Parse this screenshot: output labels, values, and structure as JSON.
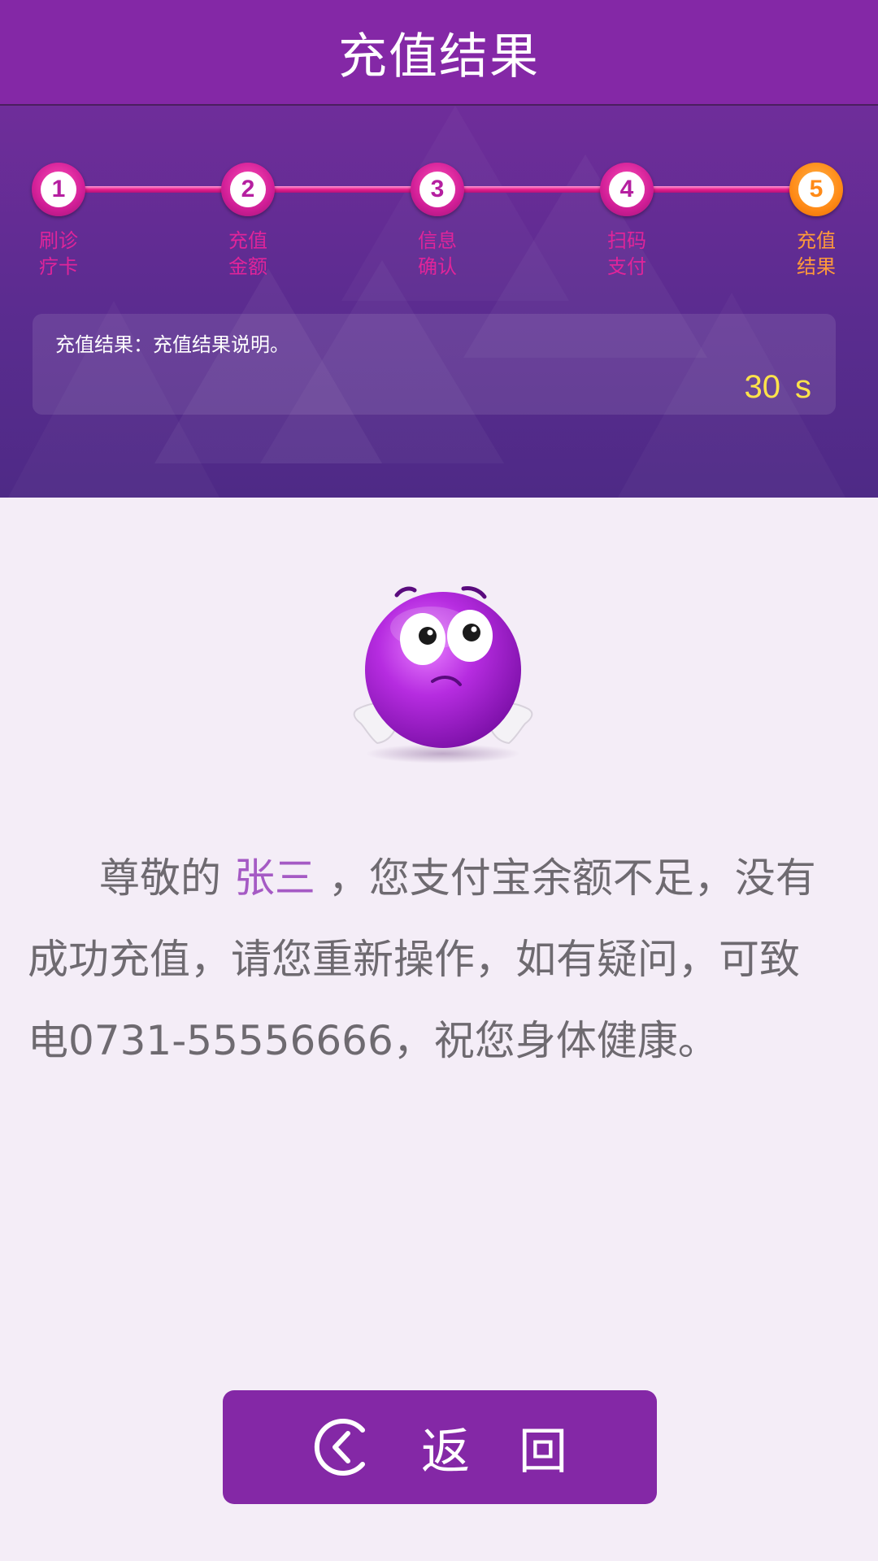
{
  "header": {
    "title": "充值结果"
  },
  "steps": [
    {
      "number": "1",
      "line1": "刷诊",
      "line2": "疗卡"
    },
    {
      "number": "2",
      "line1": "充值",
      "line2": "金额"
    },
    {
      "number": "3",
      "line1": "信息",
      "line2": "确认"
    },
    {
      "number": "4",
      "line1": "扫码",
      "line2": "支付"
    },
    {
      "number": "5",
      "line1": "充值",
      "line2": "结果"
    }
  ],
  "active_step": 5,
  "info": {
    "text": "充值结果：充值结果说明。",
    "countdown_value": "30",
    "countdown_unit": "s"
  },
  "emoji": {
    "icon": "confused-shrug-emoji-icon"
  },
  "message": {
    "prefix": "尊敬的",
    "name": "张三",
    "body": "，您支付宝余额不足，没有成功充值，请您重新操作，如有疑问，可致电0731-55556666，祝您身体健康。"
  },
  "return_button": {
    "label": "返回",
    "icon": "back-circle-icon"
  },
  "colors": {
    "header": "#8428a6",
    "step_active": "#ff8a17",
    "step_default": "#d11e97",
    "countdown": "#ffe34a",
    "name_highlight": "#a55ac4"
  }
}
